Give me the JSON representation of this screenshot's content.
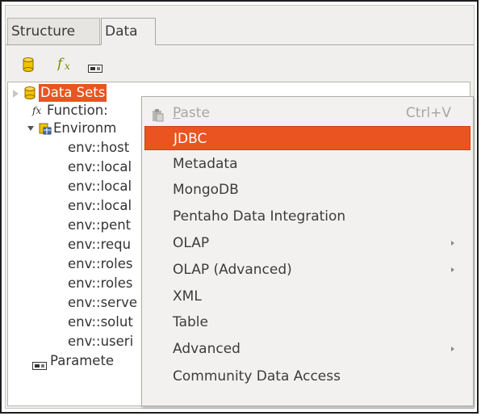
{
  "tabs": [
    {
      "label": "Structure"
    },
    {
      "label": "Data"
    }
  ],
  "toolbar": {
    "icons": [
      "datasource-icon",
      "function-icon",
      "parameter-icon"
    ],
    "colors": {
      "cylinder": "#f2c200",
      "fx": "#6f8f00"
    }
  },
  "tree": {
    "items": [
      {
        "label": "Data Sets",
        "icon": "database-icon",
        "selected": true,
        "expander": "collapsed"
      },
      {
        "label": "Function:",
        "icon": "function-icon"
      },
      {
        "label": "Environm",
        "icon": "environment-icon",
        "expander": "expanded"
      },
      {
        "label": "env::host"
      },
      {
        "label": "env::local"
      },
      {
        "label": "env::local"
      },
      {
        "label": "env::local"
      },
      {
        "label": "env::pent"
      },
      {
        "label": "env::requ"
      },
      {
        "label": "env::roles"
      },
      {
        "label": "env::roles"
      },
      {
        "label": "env::serve"
      },
      {
        "label": "env::solut"
      },
      {
        "label": "env::useri"
      },
      {
        "label": "Paramete",
        "icon": "parameter-icon"
      }
    ]
  },
  "context_menu": {
    "paste": {
      "label": "Paste",
      "mnemonic": "P",
      "rest": "aste",
      "shortcut": "Ctrl+V",
      "enabled": false
    },
    "items": [
      {
        "label": "JDBC",
        "highlighted": true
      },
      {
        "label": "Metadata"
      },
      {
        "label": "MongoDB"
      },
      {
        "label": "Pentaho Data Integration"
      },
      {
        "label": "OLAP",
        "submenu": true
      },
      {
        "label": "OLAP (Advanced)",
        "submenu": true
      },
      {
        "label": "XML"
      },
      {
        "label": "Table"
      },
      {
        "label": "Advanced",
        "submenu": true
      },
      {
        "label": "Community Data Access"
      }
    ]
  },
  "colors": {
    "accent": "#e95420",
    "panel": "#f0efed",
    "menu": "#f2f1f0"
  }
}
